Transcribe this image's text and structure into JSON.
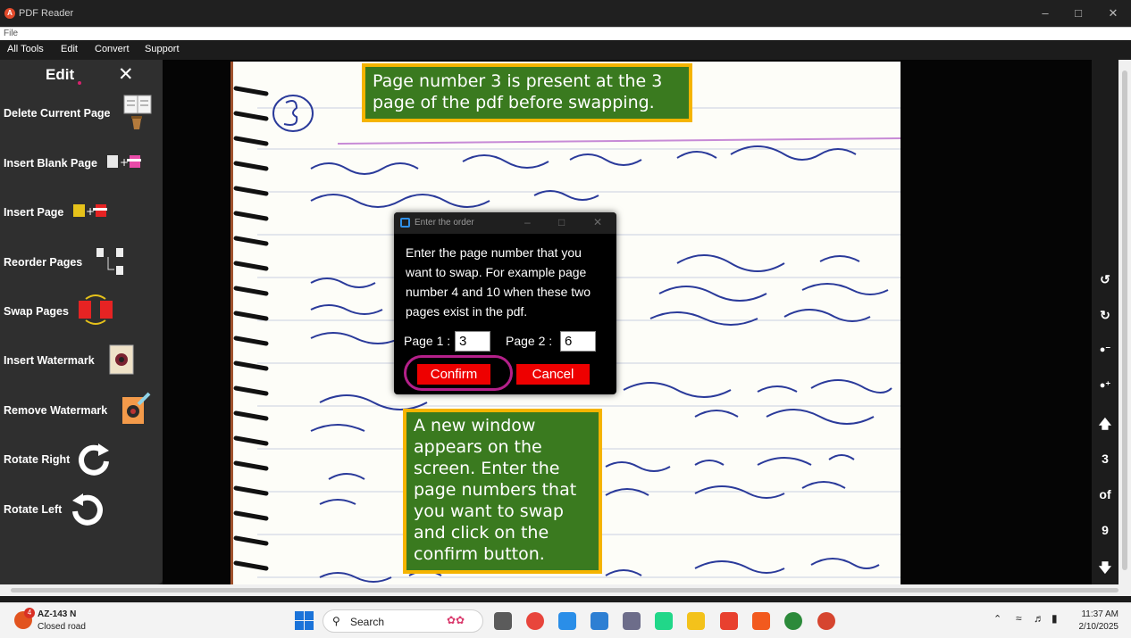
{
  "window": {
    "title": "PDF Reader"
  },
  "filebar": {
    "label": "File"
  },
  "menu": [
    "All Tools",
    "Edit",
    "Convert",
    "Support"
  ],
  "sidebar": {
    "heading": "Edit",
    "items": [
      {
        "label": "Delete Current Page",
        "icon": "delete-page-icon"
      },
      {
        "label": "Insert Blank Page",
        "icon": "insert-blank-page-icon"
      },
      {
        "label": "Insert Page",
        "icon": "insert-page-icon"
      },
      {
        "label": "Reorder Pages",
        "icon": "reorder-pages-icon"
      },
      {
        "label": "Swap Pages",
        "icon": "swap-pages-icon"
      },
      {
        "label": "Insert Watermark",
        "icon": "insert-watermark-icon"
      },
      {
        "label": "Remove Watermark",
        "icon": "remove-watermark-icon"
      },
      {
        "label": "Rotate Right",
        "icon": "rotate-right-icon"
      },
      {
        "label": "Rotate Left",
        "icon": "rotate-left-icon"
      }
    ]
  },
  "callouts": {
    "top": "Page number 3 is present at the 3 page of the pdf before swapping.",
    "bottom": "A new window appears on the screen. Enter the page numbers that you want to swap and click on the confirm button."
  },
  "dialog": {
    "title": "Enter the order",
    "message": "Enter the page number that you want to swap. For example page number 4 and 10 when these two pages exist in the pdf.",
    "page1_label": "Page 1 :",
    "page1_value": "3",
    "page2_label": "Page 2 :",
    "page2_value": "6",
    "confirm": "Confirm",
    "cancel": "Cancel"
  },
  "navigation": {
    "current_page": "3",
    "of_label": "of",
    "total_pages": "9"
  },
  "taskbar": {
    "weather_title": "AZ-143 N",
    "weather_sub": "Closed road",
    "notification_count": "4",
    "search_label": "Search",
    "time": "11:37 AM",
    "date": "2/10/2025"
  },
  "colors": {
    "accent_red": "#ee0000",
    "callout_green": "#3a7a1f",
    "callout_border": "#f5b400",
    "highlight_ring": "#b5208a"
  }
}
